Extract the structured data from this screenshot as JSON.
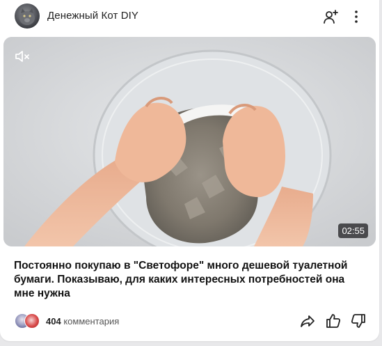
{
  "header": {
    "channel_name": "Денежный Кот DIY"
  },
  "video": {
    "duration": "02:55",
    "muted": true
  },
  "title": "Постоянно покупаю в \"Светофоре\" много дешевой туалетной бумаги. Показываю, для каких интересных потребностей она мне нужна",
  "footer": {
    "comment_count": "404",
    "comment_label": "комментария"
  },
  "icons": {
    "subscribe": "person-plus-icon",
    "more": "more-vertical-icon",
    "mute": "muted-speaker-icon",
    "share": "share-arrow-icon",
    "like": "thumbs-up-icon",
    "dislike": "thumbs-down-icon"
  }
}
